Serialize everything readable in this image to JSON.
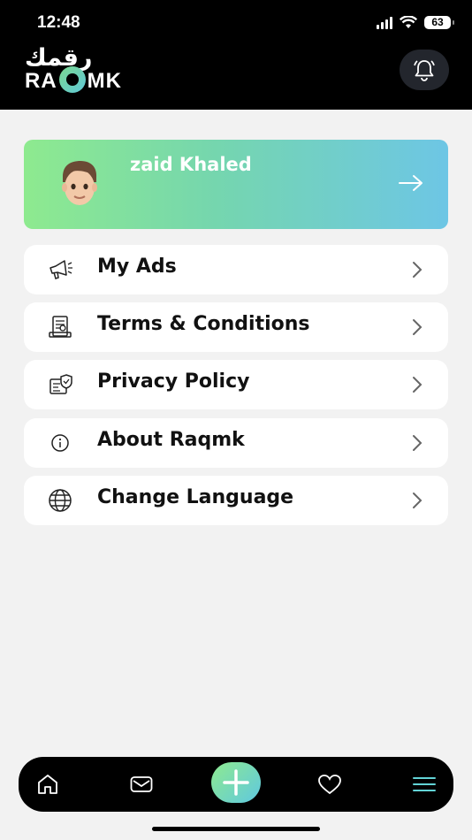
{
  "status_bar": {
    "time": "12:48",
    "battery": "63"
  },
  "header": {
    "logo_arabic": "رقمك",
    "logo_latin_prefix": "RA",
    "logo_latin_suffix": "MK",
    "notification_icon": "bell-icon"
  },
  "profile": {
    "name": "zaid Khaled",
    "arrow_icon": "arrow-right-icon"
  },
  "menu": [
    {
      "label": "My Ads",
      "icon": "megaphone-icon"
    },
    {
      "label": "Terms & Conditions",
      "icon": "document-icon"
    },
    {
      "label": "Privacy Policy",
      "icon": "privacy-shield-icon"
    },
    {
      "label": "About Raqmk",
      "icon": "info-icon"
    },
    {
      "label": "Change Language",
      "icon": "globe-icon"
    }
  ],
  "bottom_nav": {
    "items": [
      "home-icon",
      "mail-icon",
      "add-icon",
      "heart-icon",
      "menu-icon"
    ],
    "active": "menu-icon"
  },
  "colors": {
    "accent_green": "#8eea8f",
    "accent_blue": "#6dc6e5",
    "header_bg": "#000000",
    "page_bg": "#f2f2f2"
  }
}
